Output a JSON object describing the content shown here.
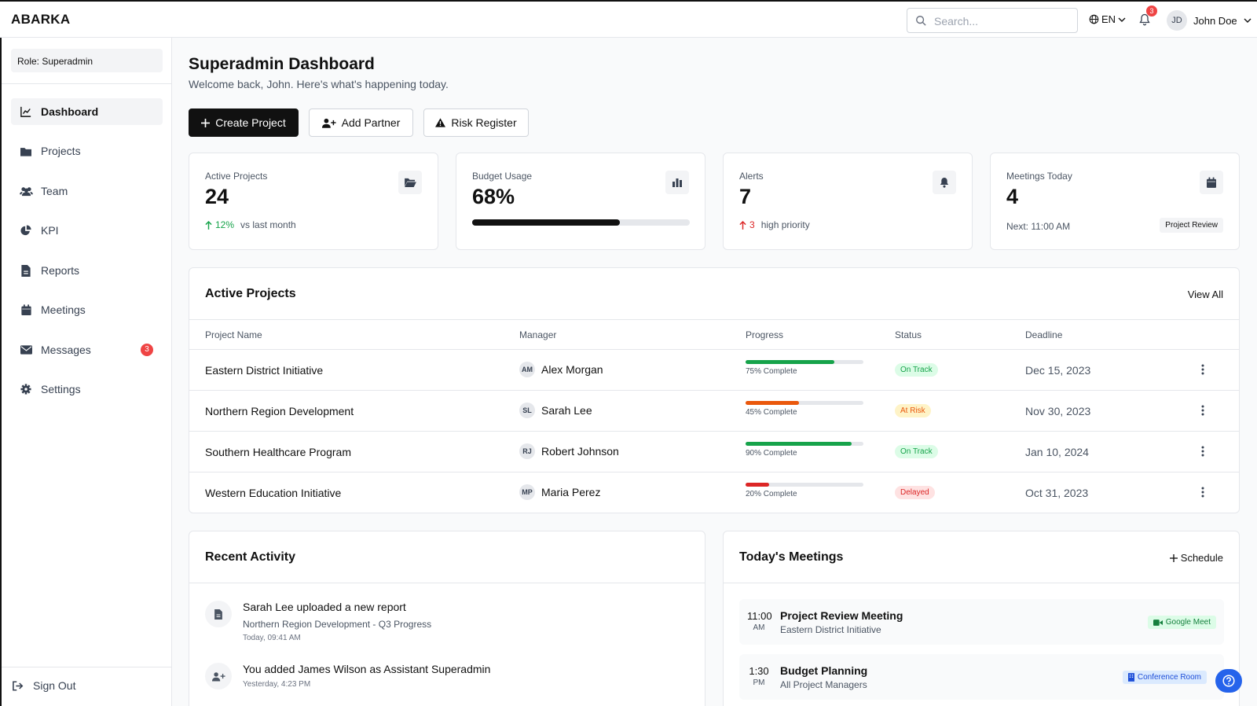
{
  "app": {
    "logo": "ABARKA"
  },
  "topbar": {
    "search_placeholder": "Search...",
    "language": "EN",
    "notifications_count": "3",
    "user_initials": "JD",
    "user_name": "John Doe"
  },
  "sidebar": {
    "role": "Role: Superadmin",
    "items": [
      {
        "label": "Dashboard",
        "icon": "chart-line-icon",
        "active": true
      },
      {
        "label": "Projects",
        "icon": "folder-icon"
      },
      {
        "label": "Team",
        "icon": "users-icon"
      },
      {
        "label": "KPI",
        "icon": "pie-chart-icon"
      },
      {
        "label": "Reports",
        "icon": "file-icon"
      },
      {
        "label": "Meetings",
        "icon": "calendar-icon"
      },
      {
        "label": "Messages",
        "icon": "envelope-icon",
        "badge": "3"
      },
      {
        "label": "Settings",
        "icon": "gear-icon"
      }
    ],
    "sign_out": "Sign Out"
  },
  "header": {
    "title": "Superadmin Dashboard",
    "subtitle": "Welcome back, John. Here's what's happening today."
  },
  "actions": {
    "create_project": "Create Project",
    "add_partner": "Add Partner",
    "risk_register": "Risk Register"
  },
  "stats": {
    "active_projects": {
      "label": "Active Projects",
      "value": "24",
      "change": "12%",
      "change_text": "vs last month"
    },
    "budget_usage": {
      "label": "Budget Usage",
      "value": "68%",
      "fraction": 0.68
    },
    "alerts": {
      "label": "Alerts",
      "value": "7",
      "count": "3",
      "count_text": "high priority"
    },
    "meetings_today": {
      "label": "Meetings Today",
      "value": "4",
      "next": "Next: 11:00 AM",
      "tag": "Project Review"
    }
  },
  "projects": {
    "title": "Active Projects",
    "view_all": "View All",
    "columns": [
      "Project Name",
      "Manager",
      "Progress",
      "Status",
      "Deadline"
    ],
    "rows": [
      {
        "name": "Eastern District Initiative",
        "initials": "AM",
        "manager": "Alex Morgan",
        "progress": 0.75,
        "progress_text": "75% Complete",
        "status": "On Track",
        "deadline": "Dec 15, 2023"
      },
      {
        "name": "Northern Region Development",
        "initials": "SL",
        "manager": "Sarah Lee",
        "progress": 0.45,
        "progress_text": "45% Complete",
        "status": "At Risk",
        "deadline": "Nov 30, 2023"
      },
      {
        "name": "Southern Healthcare Program",
        "initials": "RJ",
        "manager": "Robert Johnson",
        "progress": 0.9,
        "progress_text": "90% Complete",
        "status": "On Track",
        "deadline": "Jan 10, 2024"
      },
      {
        "name": "Western Education Initiative",
        "initials": "MP",
        "manager": "Maria Perez",
        "progress": 0.2,
        "progress_text": "20% Complete",
        "status": "Delayed",
        "deadline": "Oct 31, 2023"
      }
    ]
  },
  "activity": {
    "title": "Recent Activity",
    "items": [
      {
        "title": "Sarah Lee uploaded a new report",
        "detail": "Northern Region Development - Q3 Progress",
        "time": "Today, 09:41 AM",
        "icon": "file-icon"
      },
      {
        "title": "You added James Wilson as Assistant Superadmin",
        "detail": "",
        "time": "Yesterday, 4:23 PM",
        "icon": "user-plus-icon"
      }
    ]
  },
  "meetings": {
    "title": "Today's Meetings",
    "schedule": "Schedule",
    "items": [
      {
        "time": "11:00",
        "ampm": "AM",
        "title": "Project Review Meeting",
        "sub": "Eastern District Initiative",
        "tag": "Google Meet",
        "tag_icon": "video-icon"
      },
      {
        "time": "1:30",
        "ampm": "PM",
        "title": "Budget Planning",
        "sub": "All Project Managers",
        "tag": "Conference Room",
        "tag_icon": "building-icon"
      }
    ]
  },
  "colors": {
    "on_track": "#16a34a",
    "at_risk": "#ea580c",
    "delayed": "#dc2626",
    "accent": "#111111"
  }
}
